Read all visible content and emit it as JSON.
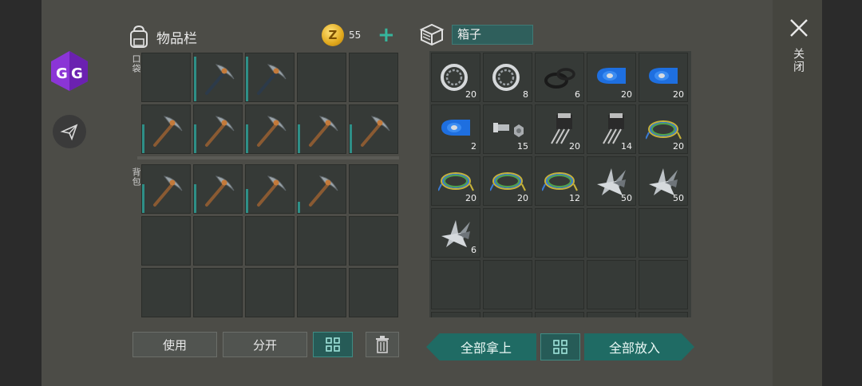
{
  "inventory": {
    "title": "物品栏",
    "coin_count": "55",
    "pocket_label": "口袋",
    "backpack_label": "背包"
  },
  "chest": {
    "name": "箱子"
  },
  "buttons": {
    "use": "使用",
    "split": "分开",
    "take_all": "全部拿上",
    "put_all": "全部放入"
  },
  "close_label": "关闭",
  "inventory_slots": [
    "empty",
    "pickaxe-dark",
    "pickaxe-dark",
    "empty",
    "empty",
    "pickaxe",
    "pickaxe",
    "pickaxe",
    "pickaxe",
    "pickaxe",
    "pickaxe",
    "pickaxe",
    "pickaxe",
    "pickaxe",
    "empty",
    "empty",
    "empty",
    "empty",
    "empty",
    "empty",
    "empty",
    "empty",
    "empty",
    "empty",
    "empty"
  ],
  "chest_items": [
    {
      "item": "bearing",
      "qty": "20"
    },
    {
      "item": "bearing",
      "qty": "8"
    },
    {
      "item": "rubber-seal",
      "qty": "6"
    },
    {
      "item": "blue-tape",
      "qty": "20"
    },
    {
      "item": "blue-tape",
      "qty": "20"
    },
    {
      "item": "blue-tape",
      "qty": "2"
    },
    {
      "item": "bolt-nut",
      "qty": "15"
    },
    {
      "item": "transistor",
      "qty": "20"
    },
    {
      "item": "transistor",
      "qty": "14"
    },
    {
      "item": "wire",
      "qty": "20"
    },
    {
      "item": "wire",
      "qty": "20"
    },
    {
      "item": "wire",
      "qty": "20"
    },
    {
      "item": "wire",
      "qty": "12"
    },
    {
      "item": "metal-scrap",
      "qty": "50"
    },
    {
      "item": "metal-scrap",
      "qty": "50"
    },
    {
      "item": "metal-scrap",
      "qty": "6"
    }
  ],
  "colors": {
    "accent": "#2e8f87",
    "panel": "#4c4c47",
    "slot": "#363a37",
    "coin": "#e0a81c"
  }
}
